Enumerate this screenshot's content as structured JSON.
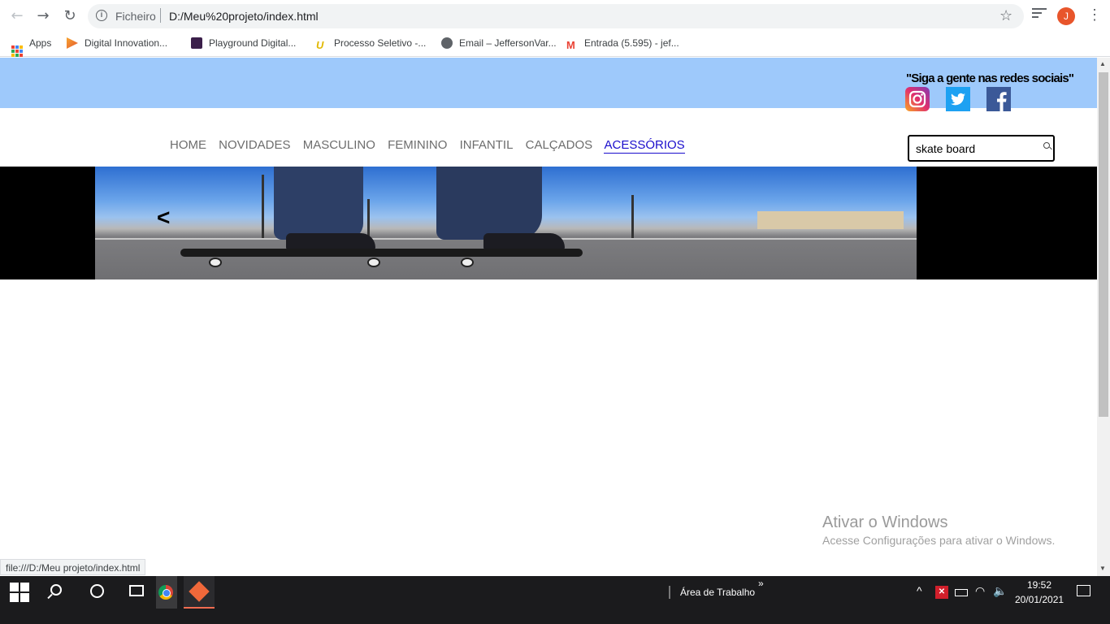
{
  "browser": {
    "scheme_label": "Ficheiro",
    "url": "D:/Meu%20projeto/index.html",
    "avatar_letter": "J",
    "bookmarks": [
      {
        "label": "Apps"
      },
      {
        "label": "Digital Innovation..."
      },
      {
        "label": "Playground Digital..."
      },
      {
        "label": "Processo Seletivo -..."
      },
      {
        "label": "Email – JeffersonVar..."
      },
      {
        "label": "Entrada (5.595) - jef..."
      }
    ],
    "status_link": "file:///D:/Meu projeto/index.html"
  },
  "site": {
    "social_heading": "\"Siga a gente nas redes sociais\"",
    "menu": [
      {
        "label": "HOME"
      },
      {
        "label": "NOVIDADES"
      },
      {
        "label": "MASCULINO"
      },
      {
        "label": "FEMININO"
      },
      {
        "label": "INFANTIL"
      },
      {
        "label": "CALÇADOS"
      },
      {
        "label": "ACESSÓRIOS"
      }
    ],
    "search_value": "skate board",
    "carousel_prev": "<"
  },
  "windows_watermark": {
    "title": "Ativar o Windows",
    "subtitle": "Acesse Configurações para ativar o Windows."
  },
  "taskbar": {
    "desktop_label": "Área de Trabalho",
    "chevrons": "»",
    "time": "19:52",
    "date": "20/01/2021"
  },
  "colors": {
    "topband": "#9ec9fb",
    "active_menu": "#1a0dcc"
  }
}
